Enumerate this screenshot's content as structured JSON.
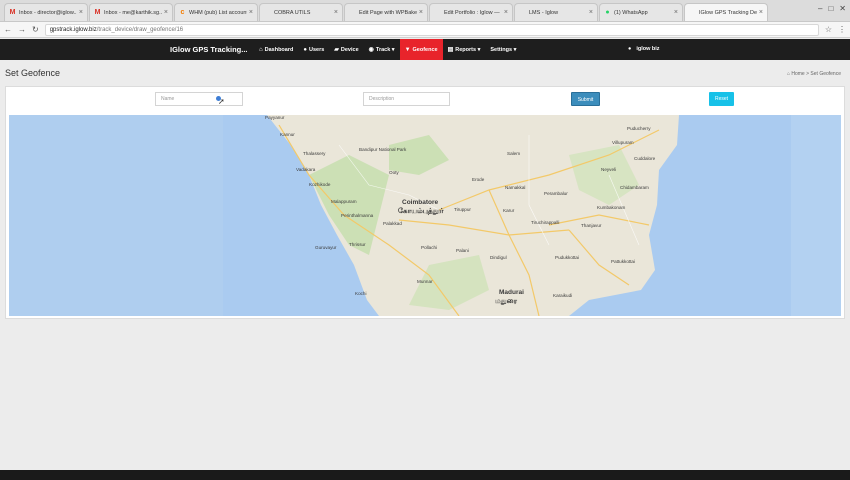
{
  "browser": {
    "tabs": [
      {
        "label": "Inbox - director@iglow...",
        "fav": "M",
        "fav_color": "#d93025"
      },
      {
        "label": "Inbox - me@karthik.sg...",
        "fav": "M",
        "fav_color": "#d93025"
      },
      {
        "label": "WHM (pub) List accounts",
        "fav": "c",
        "fav_color": "#f57c00"
      },
      {
        "label": "COBRA UTILS",
        "fav": "",
        "fav_color": "#9e9e9e"
      },
      {
        "label": "Edit Page with WPBaker",
        "fav": "",
        "fav_color": "#9e9e9e"
      },
      {
        "label": "Edit Portfolio : Iglow —",
        "fav": "",
        "fav_color": "#9e9e9e"
      },
      {
        "label": "LMS - Iglow",
        "fav": "",
        "fav_color": "#9e9e9e"
      },
      {
        "label": "(1) WhatsApp",
        "fav": "●",
        "fav_color": "#25d366"
      },
      {
        "label": "IGlow GPS Tracking Dev",
        "fav": "",
        "fav_color": "#9e9e9e"
      }
    ],
    "url_host": "gpstrack.iglow.biz",
    "url_path": "/track_device/draw_geofence/16"
  },
  "navbar": {
    "brand": "IGlow GPS Tracking...",
    "items": [
      {
        "label": "Dashboard",
        "icon": "dashboard-icon",
        "glyph": "⌂"
      },
      {
        "label": "Users",
        "icon": "user-icon",
        "glyph": "●"
      },
      {
        "label": "Device",
        "icon": "car-icon",
        "glyph": "▰"
      },
      {
        "label": "Track ▾",
        "icon": "map-marker-icon",
        "glyph": "◉"
      },
      {
        "label": "Geofence",
        "icon": "geofence-marker-icon",
        "glyph": "▼"
      },
      {
        "label": "Reports ▾",
        "icon": "report-icon",
        "glyph": "▤"
      },
      {
        "label": "Settings ▾",
        "icon": "",
        "glyph": ""
      }
    ],
    "active_color": "#e8242b",
    "user": "iglow biz"
  },
  "page": {
    "title": "Set Geofence",
    "breadcrumb_home": "Home",
    "breadcrumb_sep": ">",
    "breadcrumb_current": "Set Geofence"
  },
  "form": {
    "name_placeholder": "Name",
    "description_placeholder": "Description",
    "submit_label": "Submit",
    "reset_label": "Reset"
  },
  "map": {
    "places": [
      "Payyanur",
      "Kannur",
      "Thalassery",
      "Vadakara",
      "Kozhikode",
      "Malappuram",
      "Perinthalmanna",
      "Guruvayur",
      "Thrissur",
      "Palakkad",
      "Kochi",
      "Coimbatore",
      "Tiruppur",
      "Pollachi",
      "Palani",
      "Dindigul",
      "Madurai",
      "Salem",
      "Erode",
      "Namakkal",
      "Karur",
      "Tiruchirappalli",
      "Thanjavur",
      "Pudukkottai",
      "Pattukkottai",
      "Kumbakonam",
      "Chidambaram",
      "Neyveli",
      "Cuddalore",
      "Villupuram",
      "Puducherry",
      "Perambalur",
      "Bandipur National Park",
      "Ooty",
      "Munnar",
      "Karaikudi"
    ],
    "places_local": {
      "Coimbatore": "கோயம்புத்தூர்",
      "Madurai": "மதுரை"
    }
  }
}
